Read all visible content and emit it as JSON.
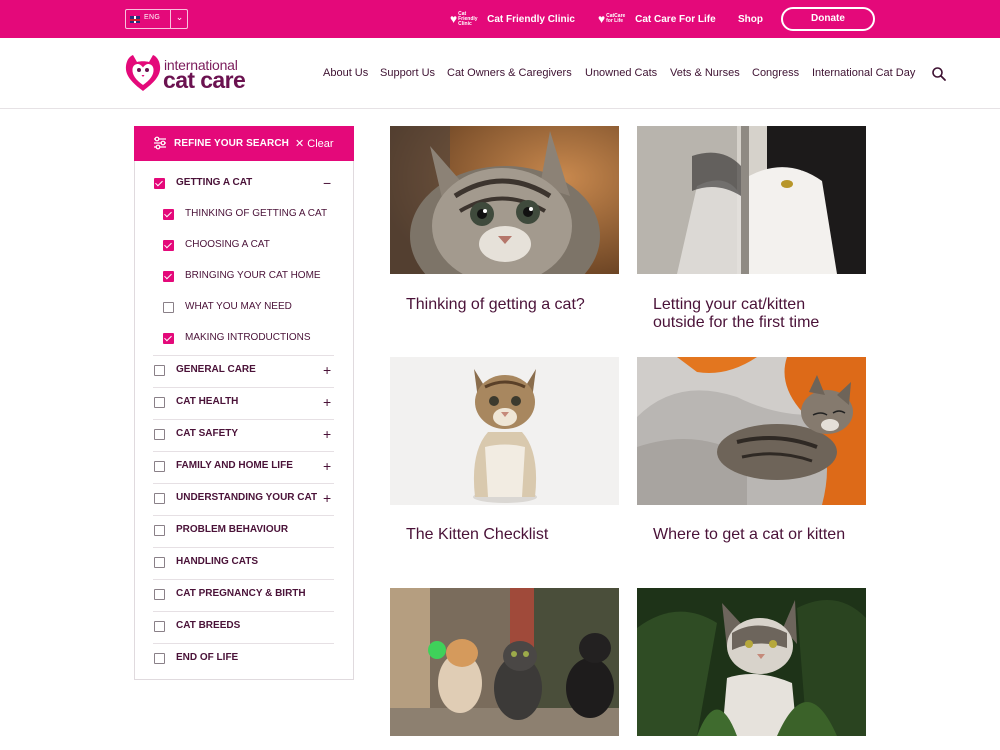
{
  "topbar": {
    "language": "ENG",
    "links": [
      {
        "logo": "Cat Friendly Clinic",
        "label": "Cat Friendly Clinic"
      },
      {
        "logo": "CatCare for Life",
        "label": "Cat Care For Life"
      },
      {
        "label": "Shop"
      }
    ],
    "donate": "Donate"
  },
  "header": {
    "logo": {
      "line1": "international",
      "line2": "cat care"
    },
    "nav": [
      "About Us",
      "Support Us",
      "Cat Owners & Caregivers",
      "Unowned Cats",
      "Vets & Nurses",
      "Congress",
      "International Cat Day"
    ]
  },
  "filter": {
    "title": "REFINE YOUR SEARCH",
    "clear": "Clear",
    "categories": [
      {
        "label": "GETTING A CAT",
        "checked": true,
        "expanded": true,
        "sub": [
          {
            "label": "THINKING OF GETTING A CAT",
            "checked": true
          },
          {
            "label": "CHOOSING A CAT",
            "checked": true
          },
          {
            "label": "BRINGING YOUR CAT HOME",
            "checked": true
          },
          {
            "label": "WHAT YOU MAY NEED",
            "checked": false
          },
          {
            "label": "MAKING INTRODUCTIONS",
            "checked": true
          }
        ]
      },
      {
        "label": "GENERAL CARE",
        "checked": false,
        "expandable": true
      },
      {
        "label": "CAT HEALTH",
        "checked": false,
        "expandable": true
      },
      {
        "label": "CAT SAFETY",
        "checked": false,
        "expandable": true
      },
      {
        "label": "FAMILY AND HOME LIFE",
        "checked": false,
        "expandable": true
      },
      {
        "label": "UNDERSTANDING YOUR CAT",
        "checked": false,
        "expandable": true
      },
      {
        "label": "PROBLEM BEHAVIOUR",
        "checked": false,
        "expandable": false
      },
      {
        "label": "HANDLING CATS",
        "checked": false,
        "expandable": false
      },
      {
        "label": "CAT PREGNANCY & BIRTH",
        "checked": false,
        "expandable": false
      },
      {
        "label": "CAT BREEDS",
        "checked": false,
        "expandable": false
      },
      {
        "label": "END OF LIFE",
        "checked": false,
        "expandable": false
      }
    ]
  },
  "cards": [
    {
      "title": "Thinking of getting a cat?"
    },
    {
      "title": "Letting your cat/kitten outside for the first time"
    },
    {
      "title": "The Kitten Checklist"
    },
    {
      "title": "Where to get a cat or kitten"
    },
    {
      "title": ""
    },
    {
      "title": ""
    }
  ],
  "colors": {
    "brand_pink": "#e4097a",
    "text_plum": "#4a1238"
  }
}
